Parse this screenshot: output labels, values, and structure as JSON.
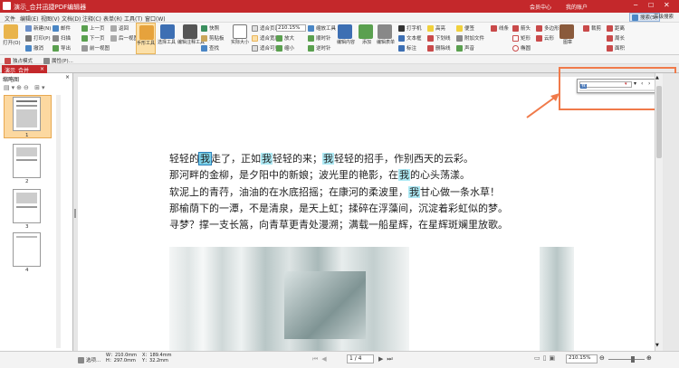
{
  "titlebar": {
    "title": "演示_合并迅捷PDF编辑器",
    "member_center": "会员中心",
    "login": "我的账户"
  },
  "menubar": {
    "items": [
      "文件",
      "编辑(E)",
      "视图(V)",
      "文档(D)",
      "注释(C)",
      "表单(R)",
      "工具(T)",
      "窗口(W)"
    ],
    "right": [
      "菜单",
      "搜索(S)",
      "高级搜索"
    ]
  },
  "ribbon": {
    "open": "打开(O)",
    "groups": [
      [
        "新建(N)",
        "打印(P)",
        "撤消"
      ],
      [
        "邮件",
        "扫描",
        "导出"
      ],
      [
        "上一页",
        "下一页",
        "前一视图"
      ],
      [
        "返回",
        "后一视图"
      ]
    ],
    "tools": [
      "手形工具",
      "选择工具",
      "编辑注释工具"
    ],
    "snapshot": "快照",
    "clipboard": "剪贴板",
    "find": "查找",
    "actual_size": "实际大小",
    "fit_page": "适合页面",
    "fit_width": "适合宽度",
    "fit_visible": "适合可见",
    "zoom_value": "210.15%",
    "zoom_in": "放大",
    "zoom_out": "缩小",
    "zoom_tool": "缩放工具",
    "rotate_cw": "顺时针",
    "rotate_ccw": "逆时针",
    "edit_content": "编辑内容",
    "add": "添加",
    "edit_form": "编辑表单",
    "type_tool": "打字机",
    "textbox": "文本框",
    "label": "标注",
    "highlight": "高亮",
    "underline": "下划线",
    "strikeout": "删除线",
    "sticky_note": "便签",
    "attach": "附加文件",
    "sound": "声音",
    "line": "线条",
    "arrow": "箭头",
    "rect": "矩形",
    "polygon": "多边形",
    "oval": "椭圆",
    "cloud": "云形",
    "stamp": "图章",
    "crop": "裁剪",
    "measure": "距离",
    "perimeter": "周长",
    "area": "面积"
  },
  "secondbar": {
    "items": [
      "独占模式",
      "属性(P)..."
    ]
  },
  "tabbar": {
    "tab": "演示_合并"
  },
  "sidepanel": {
    "title": "缩略图",
    "pages": [
      "1",
      "2",
      "3",
      "4"
    ]
  },
  "document": {
    "lines": [
      [
        "轻轻的",
        "我",
        "走了，正如",
        "我",
        "轻轻的来；",
        "我",
        "轻轻的招手，作别西天的云彩。"
      ],
      [
        "那河畔的金柳，是夕阳中的新娘；波光里的艳影，在",
        "我",
        "的心头荡漾。"
      ],
      [
        "软泥上的青荇，油油的在水底招摇；在康河的柔波里，",
        "我",
        "甘心做一条水草！"
      ],
      [
        "那榆荫下的一潭，不是清泉，是天上虹；揉碎在浮藻间，沉淀着彩虹似的梦。"
      ],
      [
        "寻梦？撑一支长篙，向青草更青处漫溯；满载一船星辉，在星辉斑斓里放歌。"
      ]
    ]
  },
  "findbar": {
    "query": "我"
  },
  "statusbar": {
    "options": "选项...",
    "width": "W：210.0mm",
    "height": "H：297.0mm",
    "x": "X：189.4mm",
    "y": "Y：32.2mm",
    "page_display": "1 / 4",
    "zoom": "210.15%"
  },
  "colors": {
    "brand": "#c4282b",
    "search_highlight": "#aeeaf5",
    "annotation": "#f07a4a"
  }
}
